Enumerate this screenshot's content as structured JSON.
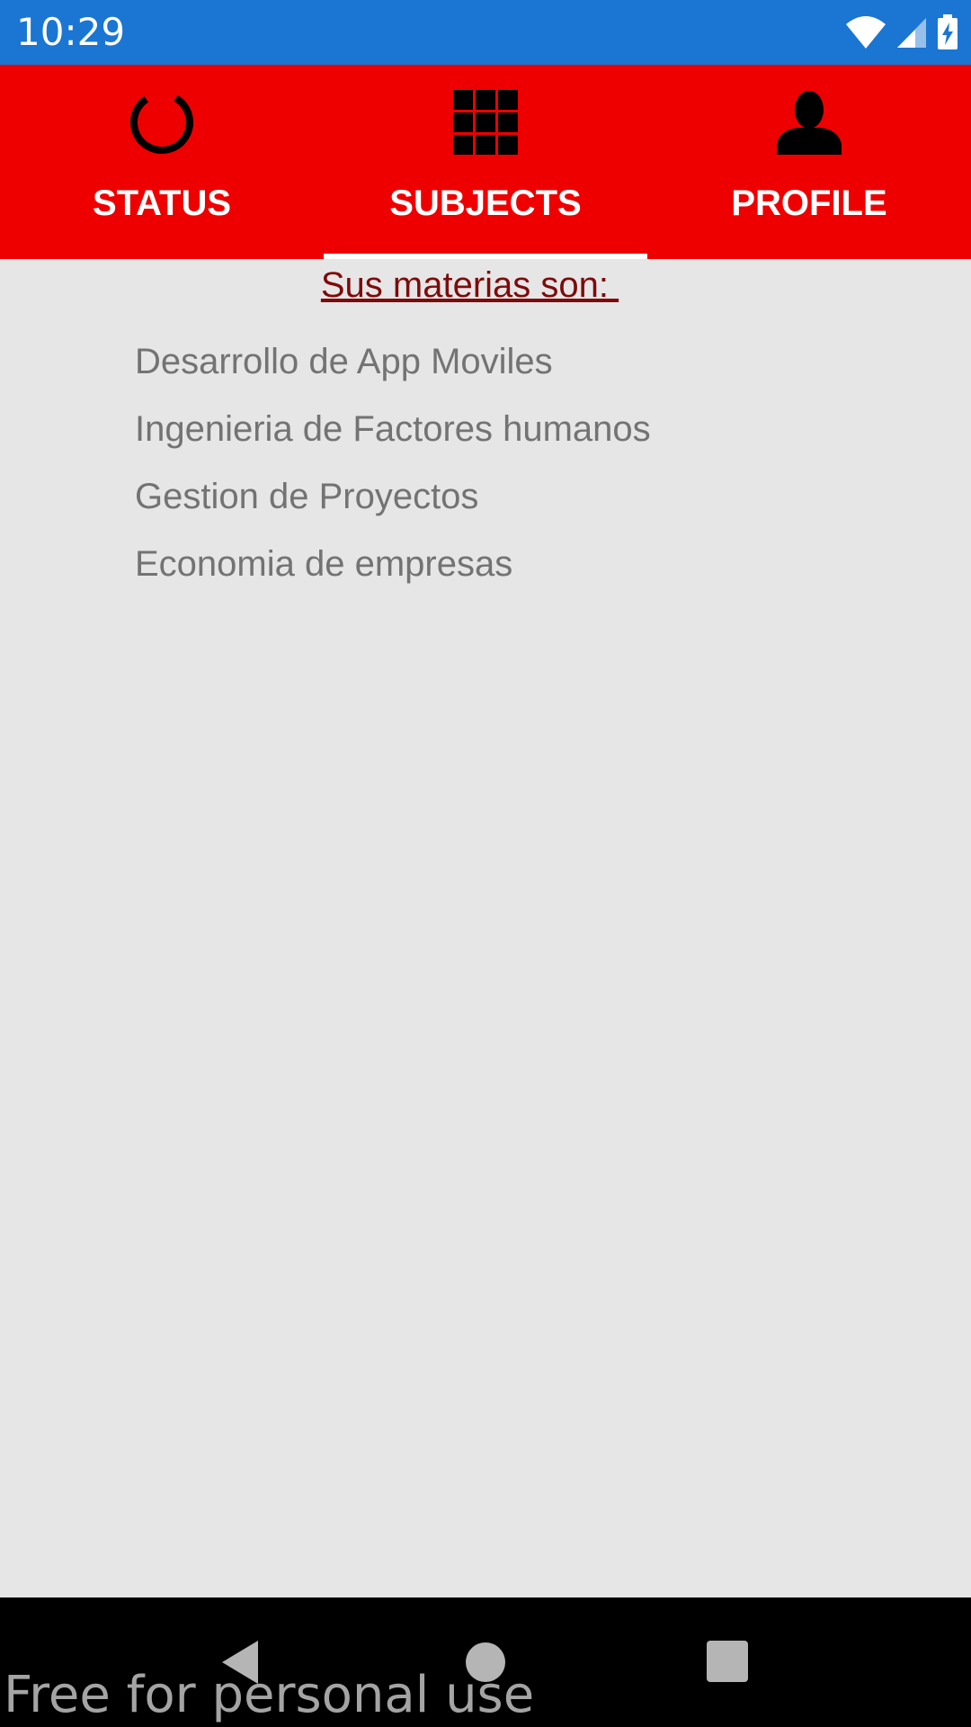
{
  "status_bar": {
    "time": "10:29",
    "icons": [
      "wifi-icon",
      "cell-signal-icon",
      "battery-charging-icon"
    ]
  },
  "tabs": [
    {
      "label": "STATUS",
      "icon": "status-ring-icon",
      "selected": false
    },
    {
      "label": "SUBJECTS",
      "icon": "grid-icon",
      "selected": true
    },
    {
      "label": "PROFILE",
      "icon": "person-icon",
      "selected": false
    }
  ],
  "content": {
    "title": "Sus materias son: ",
    "subjects": [
      "Desarrollo de App Moviles",
      "Ingenieria de Factores humanos",
      "Gestion de Proyectos",
      "Economia de empresas"
    ]
  },
  "nav_bar": {
    "buttons": [
      "back-icon",
      "home-icon",
      "recents-icon"
    ]
  },
  "watermark": "Free for personal use",
  "colors": {
    "status_bar": "#1a76d2",
    "tab_bar": "#ee0000",
    "title_text": "#7d0b0b",
    "subject_text": "#737373",
    "background": "#e6e6e6"
  }
}
